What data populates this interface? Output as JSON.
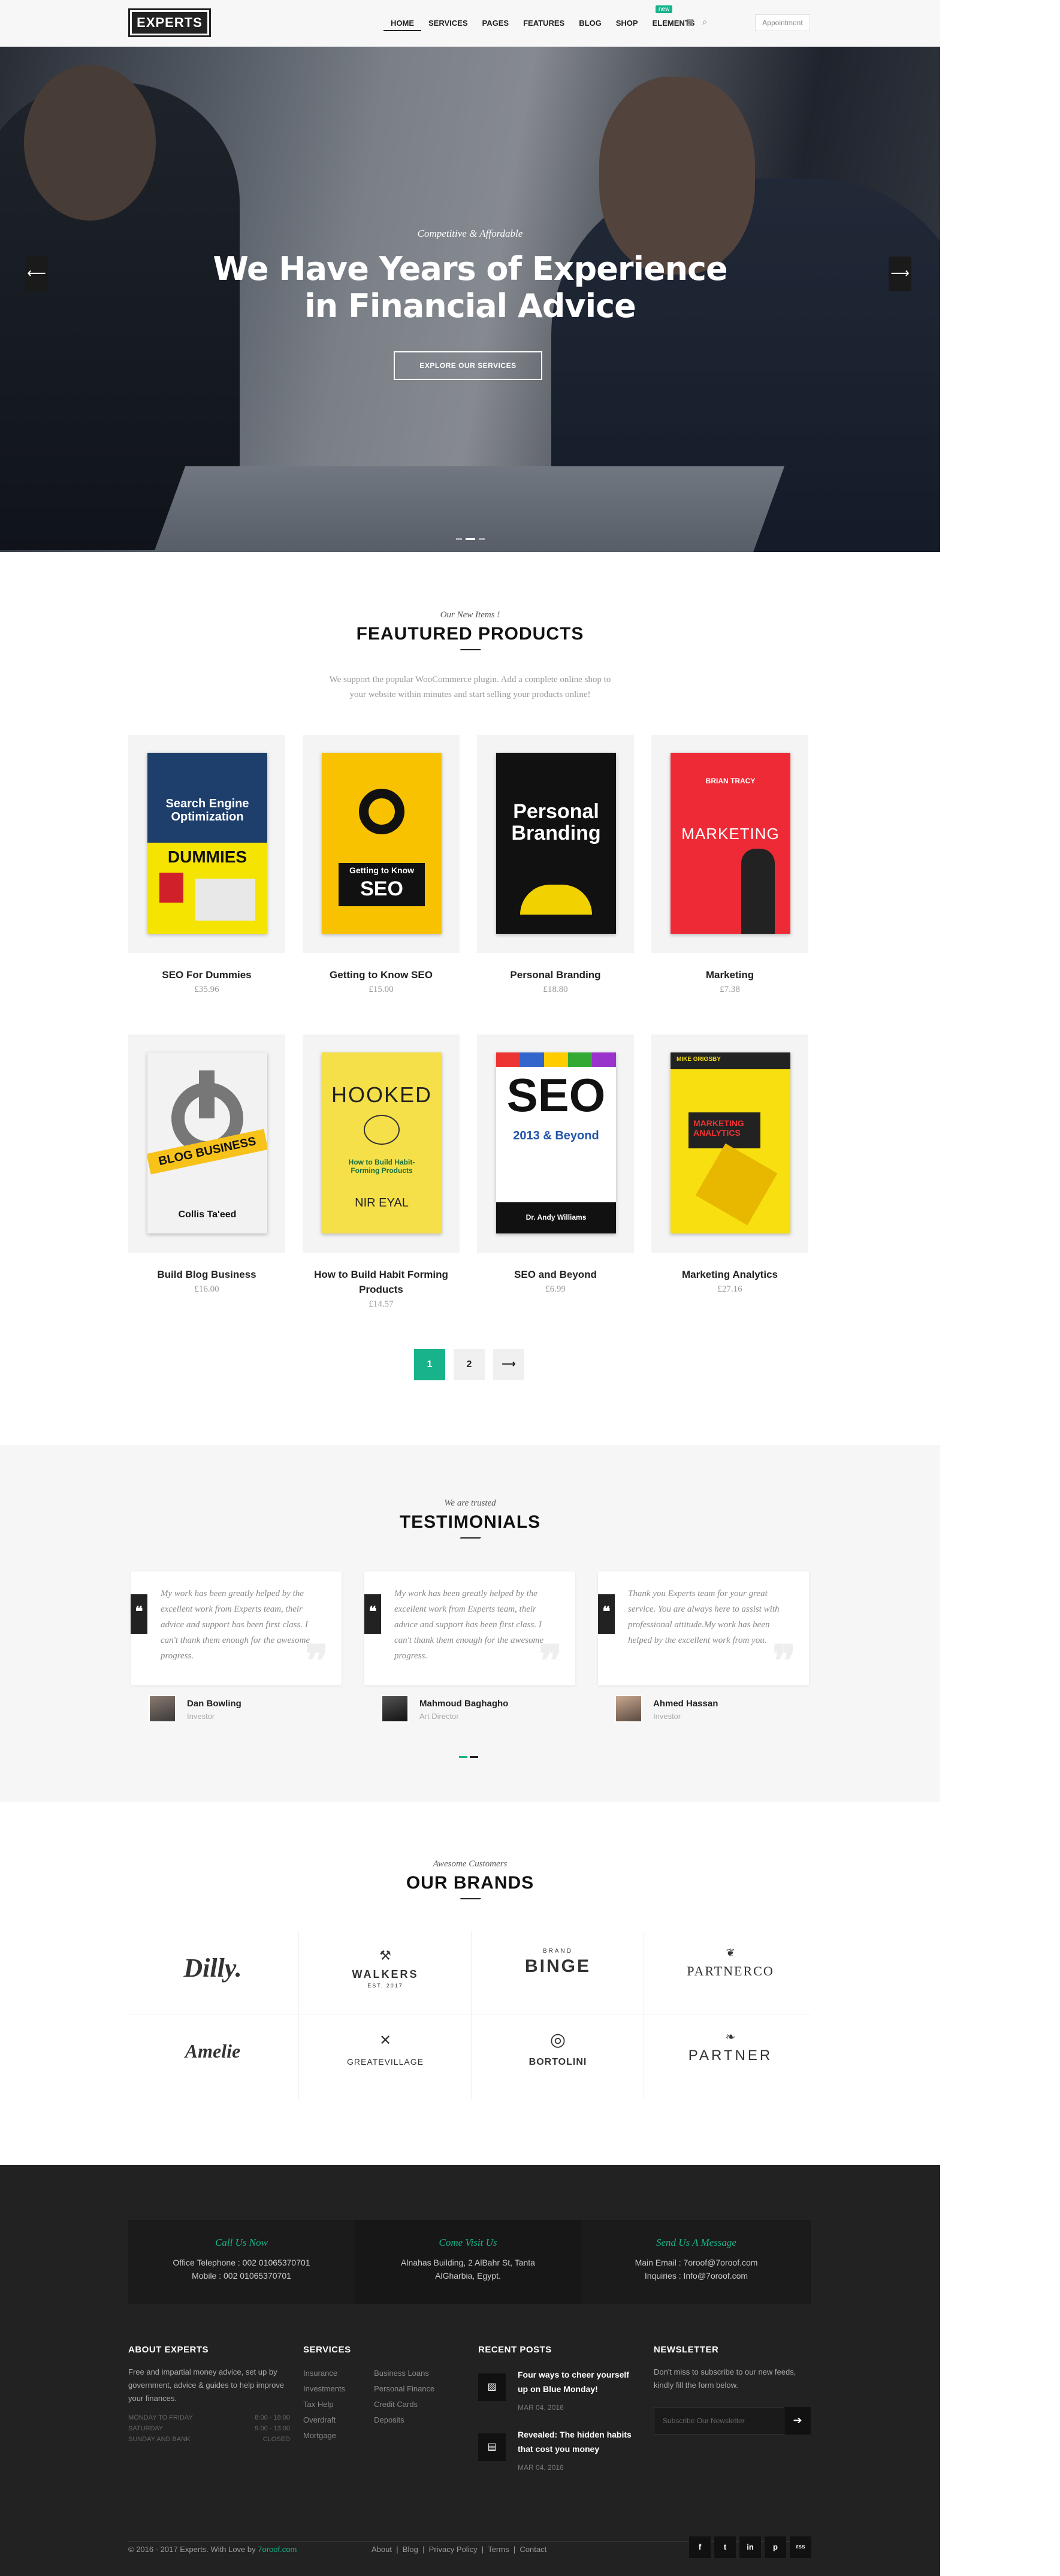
{
  "header": {
    "logo": "EXPERTS",
    "nav": [
      "HOME",
      "SERVICES",
      "PAGES",
      "FEATURES",
      "BLOG",
      "SHOP",
      "ELEMENTS"
    ],
    "new_badge": "new",
    "appointment": "Appointment"
  },
  "hero": {
    "subtitle": "Competitive & Affordable",
    "title_line1": "We Have Years of Experience",
    "title_line2": "in Financial Advice",
    "button": "EXPLORE OUR SERVICES",
    "prev_icon": "arrow-left-icon",
    "next_icon": "arrow-right-icon"
  },
  "products_section": {
    "kicker": "Our New Items !",
    "title": "FEAUTURED PRODUCTS",
    "desc_line1": "We support the popular WooCommerce plugin. Add a complete online shop to",
    "desc_line2": "your website within minutes and start selling your products online!",
    "items": [
      {
        "name": "SEO For Dummies",
        "price": "£35.96"
      },
      {
        "name": "Getting to Know SEO",
        "price": "£15.00"
      },
      {
        "name": "Personal Branding",
        "price": "£18.80"
      },
      {
        "name": "Marketing",
        "price": "£7.38"
      },
      {
        "name": "Build Blog Business",
        "price": "£16.00"
      },
      {
        "name": "How to Build Habit Forming Products",
        "price": "£14.57"
      },
      {
        "name": "SEO and Beyond",
        "price": "£6.99"
      },
      {
        "name": "Marketing Analytics",
        "price": "£27.16"
      }
    ],
    "covers": {
      "c1_top": "Search Engine Optimization",
      "c1_mid": "DUMMIES",
      "c2_top": "Getting to Know",
      "c2_big": "SEO",
      "c3_big1": "Personal",
      "c3_big2": "Branding",
      "c4_top": "BRIAN TRACY",
      "c4_big": "MARKETING",
      "c5_big": "BLOG BUSINESS",
      "c5_author": "Collis Ta'eed",
      "c6_big": "HOOKED",
      "c6_sub": "How to Build Habit-Forming Products",
      "c6_author": "NIR EYAL",
      "c7_big": "SEO",
      "c7_sub": "2013 & Beyond",
      "c7_author": "Dr. Andy Williams",
      "c8_top": "MIKE GRIGSBY",
      "c8_big": "MARKETING ANALYTICS"
    }
  },
  "pager": {
    "p1": "1",
    "p2": "2",
    "next": "⟶"
  },
  "testimonials": {
    "kicker": "We are trusted",
    "title": "TESTIMONIALS",
    "items": [
      {
        "text": "My work has been greatly helped by the excellent work from Experts team, their advice and support has been first class. I can't thank them enough for the awesome progress.",
        "name": "Dan Bowling",
        "role": "Investor"
      },
      {
        "text": "My work has been greatly helped by the excellent work from Experts team, their advice and support has been first class. I can't thank them enough for the awesome progress.",
        "name": "Mahmoud Baghagho",
        "role": "Art Director"
      },
      {
        "text": "Thank you Experts team for your great service. You are always here to assist with professional attitude.My work has been helped by the excellent work from you.",
        "name": "Ahmed Hassan",
        "role": "Investor"
      }
    ]
  },
  "brands": {
    "kicker": "Awesome Customers",
    "title": "OUR BRANDS",
    "items": [
      "Dilly.",
      "WALKERS",
      "BINGE",
      "PARTNERCO",
      "Amelie",
      "GREATEVILLAGE",
      "BORTOLINI",
      "PARTNER"
    ],
    "subs": [
      "",
      "EST. 2017",
      "BRAND",
      "",
      "",
      "",
      "",
      ""
    ]
  },
  "footer": {
    "contact": [
      {
        "heading": "Call Us Now",
        "line1": "Office Telephone : 002 01065370701",
        "line2": "Mobile : 002 01065370701"
      },
      {
        "heading": "Come Visit Us",
        "line1": "Alnahas Building, 2 AlBahr St, Tanta",
        "line2": "AlGharbia, Egypt."
      },
      {
        "heading": "Send Us A Message",
        "line1": "Main Email : 7oroof@7oroof.com",
        "line2": "Inquiries : Info@7oroof.com"
      }
    ],
    "about": {
      "title": "ABOUT EXPERTS",
      "text": "Free and impartial money advice, set up by government, advice & guides to help improve your finances.",
      "hours": [
        {
          "day": "MONDAY TO FRIDAY",
          "time": "8:00 - 18:00"
        },
        {
          "day": "SATURDAY",
          "time": "9:00 - 13:00"
        },
        {
          "day": "SUNDAY AND BANK",
          "time": "CLOSED"
        }
      ]
    },
    "services": {
      "title": "SERVICES",
      "col1": [
        "Insurance",
        "Investments",
        "Tax Help",
        "Overdraft",
        "Mortgage"
      ],
      "col2": [
        "Business Loans",
        "Personal Finance",
        "Credit Cards",
        "Deposits"
      ]
    },
    "posts": {
      "title": "RECENT POSTS",
      "items": [
        {
          "title": "Four ways to cheer yourself up on Blue Monday!",
          "date": "MAR 04, 2016",
          "icon": "image-icon"
        },
        {
          "title": "Revealed: The hidden habits that cost you money",
          "date": "MAR 04, 2016",
          "icon": "briefcase-icon"
        }
      ]
    },
    "newsletter": {
      "title": "NEWSLETTER",
      "text": "Don't miss to subscribe to our new feeds, kindly fill the form below.",
      "placeholder": "Subscribe Our Newsletter",
      "button": "➔"
    },
    "copyright": "© 2016 - 2017 Experts. With Love by",
    "author": "7oroof.com",
    "links": [
      "About",
      "Blog",
      "Privacy Policy",
      "Terms",
      "Contact"
    ],
    "social": [
      "f",
      "t",
      "in",
      "p",
      "rss"
    ]
  },
  "colors": {
    "accent": "#19b38b",
    "dark": "#222222"
  }
}
